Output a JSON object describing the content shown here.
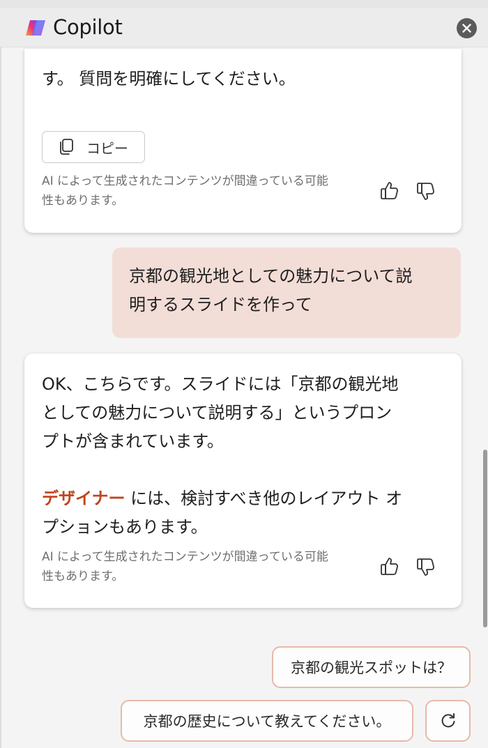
{
  "header": {
    "title": "Copilot"
  },
  "messages": {
    "m1": {
      "text": "す。 質問を明確にしてください。",
      "copy_label": "コピー",
      "disclaimer_line1": "AI によって生成されたコンテンツが間違っている可能",
      "disclaimer_line2": "性もあります。"
    },
    "user": {
      "line1": "京都の観光地としての魅力について説",
      "line2": "明するスライドを作って"
    },
    "m2": {
      "line1": "OK、こちらです。スライドには「京都の観光地",
      "line2": "としての魅力について説明する」というプロン",
      "line3": "プトが含まれています。",
      "designer_link": "デザイナー",
      "line4_rest": " には、検討すべき他のレイアウト オ",
      "line5": "プションもあります。",
      "disclaimer_line1": "AI によって生成されたコンテンツが間違っている可能",
      "disclaimer_line2": "性もあります。"
    }
  },
  "suggestions": {
    "s1": "京都の観光スポットは？",
    "s2": "京都の歴史について教えてください。"
  },
  "colors": {
    "accent_link": "#c0431e",
    "user_bubble": "#f2ddd7",
    "chip_border": "#e6b9aa"
  },
  "icons": [
    "copilot-logo",
    "close-icon",
    "copy-icon",
    "thumbs-up-icon",
    "thumbs-down-icon",
    "refresh-icon"
  ]
}
